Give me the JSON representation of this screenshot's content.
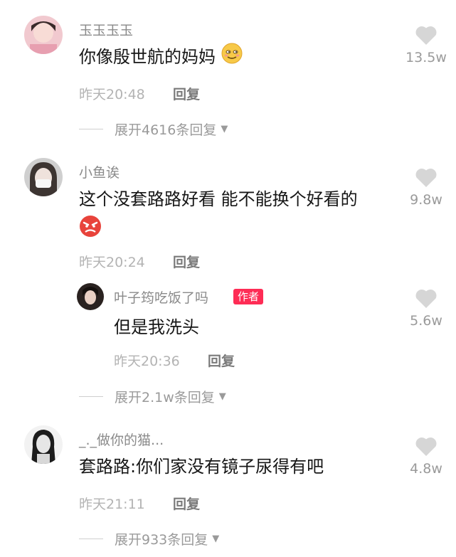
{
  "comments": [
    {
      "username": "玉玉玉玉",
      "text": "你像殷世航的妈妈",
      "emoji": "smirk-emoji",
      "time": "昨天20:48",
      "reply_label": "回复",
      "likes": "13.5w",
      "expand": "展开4616条回复"
    },
    {
      "username": "小鱼诶",
      "text": "这个没套路路好看 能不能换个好看的",
      "emoji": "angry-emoji",
      "time": "昨天20:24",
      "reply_label": "回复",
      "likes": "9.8w",
      "reply": {
        "username": "叶子筠吃饭了吗",
        "badge": "作者",
        "text": "但是我洗头",
        "time": "昨天20:36",
        "reply_label": "回复",
        "likes": "5.6w"
      },
      "expand": "展开2.1w条回复"
    },
    {
      "username": "_._做你的猫...",
      "text": "套路路:你们家没有镜子尿得有吧",
      "time": "昨天21:11",
      "reply_label": "回复",
      "likes": "4.8w",
      "expand": "展开933条回复"
    }
  ],
  "icons": {
    "like": "heart-icon",
    "expand_caret": "caret-down-icon"
  },
  "colors": {
    "badge": "#fe2c55",
    "heart": "#d6d6d6"
  }
}
